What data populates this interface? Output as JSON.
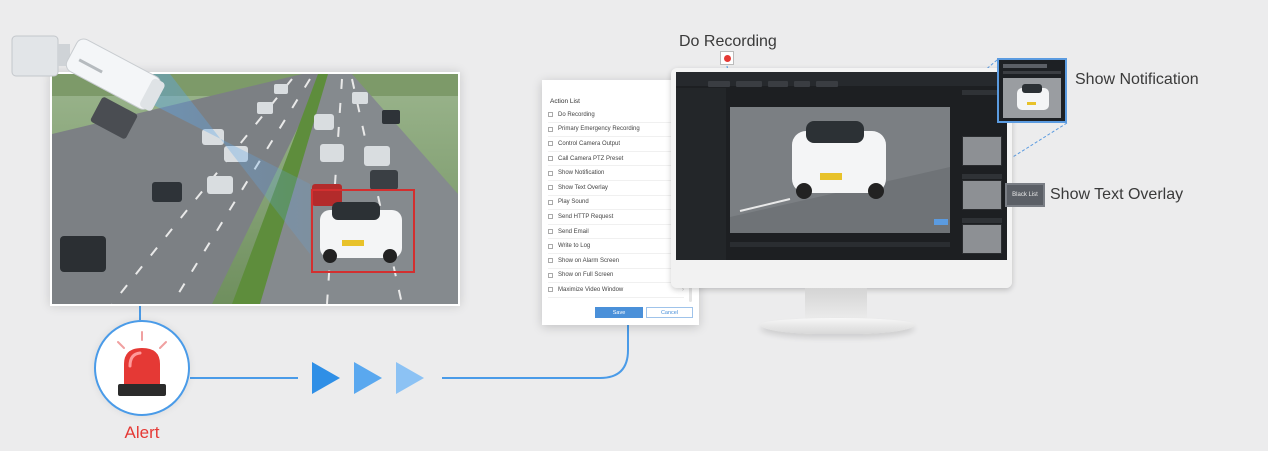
{
  "alert": {
    "label": "Alert"
  },
  "action_panel": {
    "title": "Action List",
    "items": [
      "Do Recording",
      "Primary Emergency Recording",
      "Control Camera Output",
      "Call Camera PTZ Preset",
      "Show Notification",
      "Show Text Overlay",
      "Play Sound",
      "Send HTTP Request",
      "Send Email",
      "Write to Log",
      "Show on Alarm Screen",
      "Show on Full Screen",
      "Maximize Video Window"
    ],
    "save_label": "Save",
    "cancel_label": "Cancel"
  },
  "callouts": {
    "do_recording": "Do Recording",
    "show_notification": "Show Notification",
    "show_text_overlay": "Show Text Overlay",
    "overlay_tag": "Black List"
  },
  "colors": {
    "accent_blue": "#4a9be8",
    "alert_red": "#e53935",
    "detection_box_red": "#d32f2f",
    "arrow_dark": "#2f8fe6",
    "arrow_mid": "#5aa8ef",
    "arrow_light": "#8cc2f4"
  },
  "icons": {
    "camera": "bullet-camera-icon",
    "alert": "siren-icon",
    "record": "record-dot-icon"
  }
}
